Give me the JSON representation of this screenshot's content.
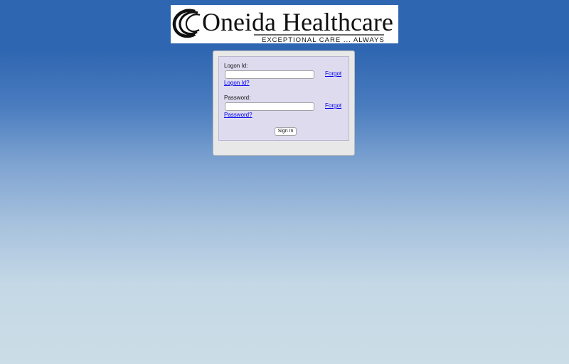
{
  "logo": {
    "brand": "Oneida Healthcare",
    "tagline": "EXCEPTIONAL CARE ... ALWAYS"
  },
  "form": {
    "logon_label": "Logon Id:",
    "logon_value": "",
    "forgot_logon_line1": "Forgot",
    "forgot_logon_line2": "Logon Id?",
    "password_label": "Password:",
    "password_value": "",
    "forgot_password_line1": "Forgot",
    "forgot_password_line2": "Password?",
    "signin_label": "Sign In"
  }
}
